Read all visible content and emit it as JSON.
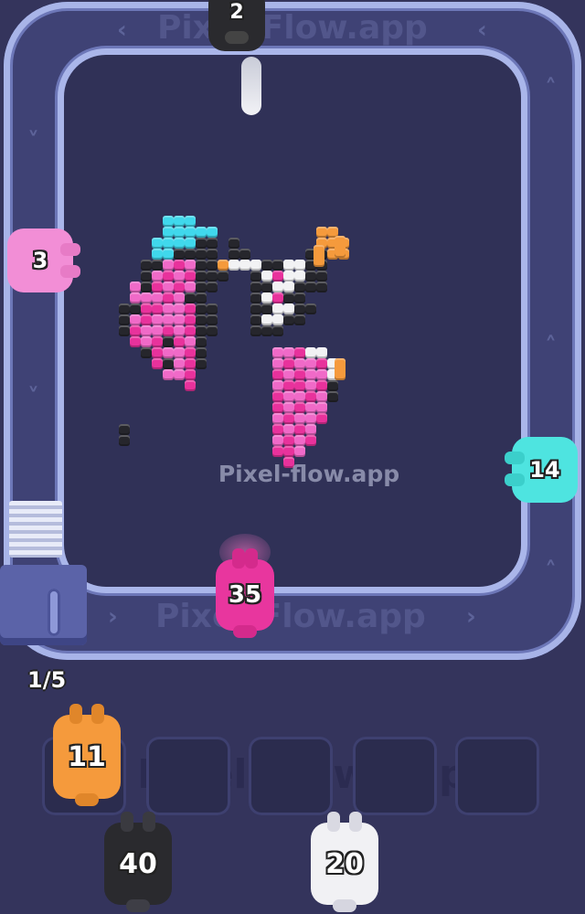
{
  "watermark": "Pixel-flow.app",
  "lane_text": "Pixel-Flow.app",
  "capacity_counter": "1/5",
  "conveyor_shooters": [
    {
      "id": "top",
      "count": "2",
      "color": "#2a2a2e"
    },
    {
      "id": "left",
      "count": "3",
      "color": "#f28ed6"
    },
    {
      "id": "right",
      "count": "14",
      "color": "#4ee4e0"
    },
    {
      "id": "bottom",
      "count": "35",
      "color": "#e8369e"
    }
  ],
  "slots": [
    {
      "count": "11",
      "color": "#f59a3c"
    },
    {
      "count": "",
      "color": ""
    },
    {
      "count": "",
      "color": ""
    },
    {
      "count": "",
      "color": ""
    },
    {
      "count": "",
      "color": ""
    }
  ],
  "queue": [
    {
      "count": "40",
      "color": "#2a2a2e"
    },
    {
      "count": "20",
      "color": "#f1f1f4"
    }
  ],
  "colors": {
    "cyan": "#40d8ec",
    "pink": "#f06ac8",
    "magenta": "#e8329c",
    "black": "#26262c",
    "white": "#f2f2f4",
    "orange": "#f59a3c"
  }
}
